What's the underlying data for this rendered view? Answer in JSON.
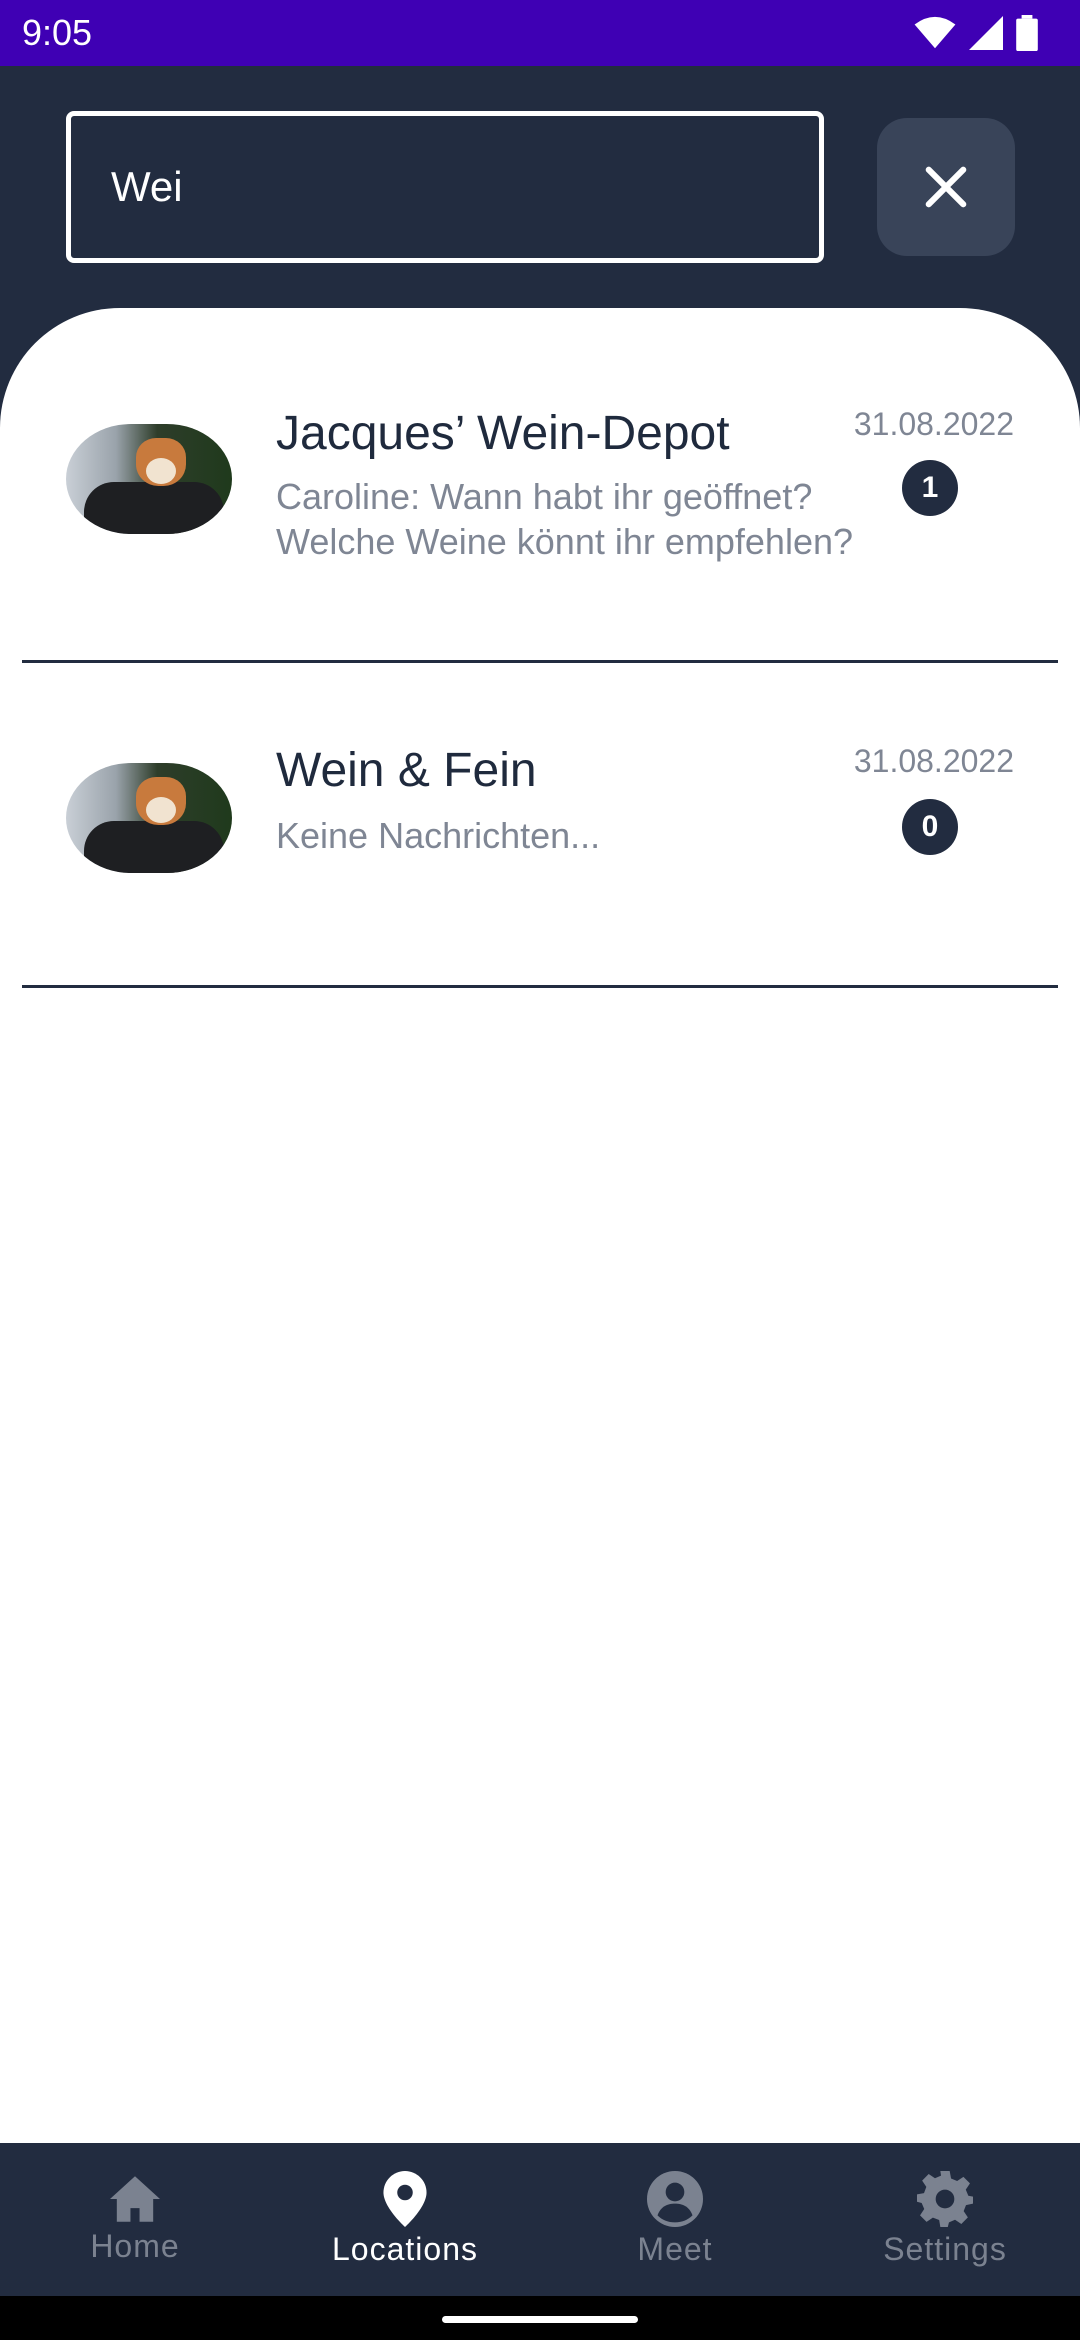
{
  "status_bar": {
    "time": "9:05"
  },
  "search": {
    "value": "Wei"
  },
  "chats": [
    {
      "title": "Jacques’ Wein-Depot",
      "preview": "Caroline: Wann habt ihr geöffnet? Welche Weine könnt ihr empfehlen?",
      "date": "31.08.2022",
      "unread": "1"
    },
    {
      "title": "Wein & Fein",
      "preview": "Keine Nachrichten...",
      "date": "31.08.2022",
      "unread": "0"
    }
  ],
  "bottom_nav": {
    "items": [
      {
        "label": "Home",
        "icon": "home-icon"
      },
      {
        "label": "Locations",
        "icon": "location-pin-icon",
        "active": true
      },
      {
        "label": "Meet",
        "icon": "account-circle-icon"
      },
      {
        "label": "Settings",
        "icon": "gear-icon"
      }
    ]
  },
  "colors": {
    "status_bar": "#3f00b4",
    "header": "#222c40",
    "badge": "#222c40",
    "nav_inactive": "#7b8290",
    "nav_active": "#ffffff"
  }
}
